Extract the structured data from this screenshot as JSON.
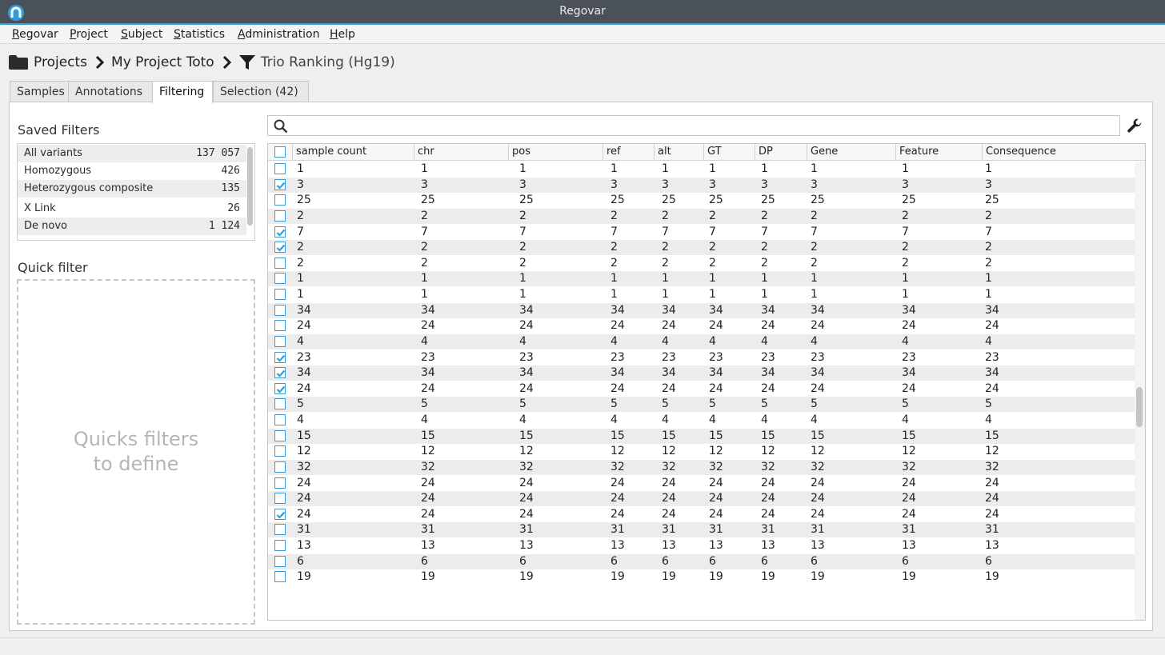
{
  "window": {
    "title": "Regovar"
  },
  "menu": [
    {
      "label": "Regovar",
      "mnemonic": "R"
    },
    {
      "label": "Project",
      "mnemonic": "P"
    },
    {
      "label": "Subject",
      "mnemonic": "S"
    },
    {
      "label": "Statistics",
      "mnemonic": "S"
    },
    {
      "label": "Administration",
      "mnemonic": "A"
    },
    {
      "label": "Help",
      "mnemonic": "H"
    }
  ],
  "breadcrumb": {
    "items": [
      "Projects",
      "My Project Toto"
    ],
    "current": "Trio Ranking (Hg19)"
  },
  "tabs": [
    {
      "label": "Samples",
      "active": false
    },
    {
      "label": "Annotations",
      "active": false
    },
    {
      "label": "Filtering",
      "active": true
    },
    {
      "label": "Selection (42)",
      "active": false
    }
  ],
  "saved_filters": {
    "title": "Saved Filters",
    "items": [
      {
        "name": "All variants",
        "count": "137 057"
      },
      {
        "name": "Homozygous",
        "count": "426"
      },
      {
        "name": "Heterozygous composite",
        "count": "135"
      },
      {
        "name": "X Link",
        "count": "26"
      },
      {
        "name": "De novo",
        "count": "1 124"
      }
    ]
  },
  "quick_filter": {
    "title": "Quick filter",
    "placeholder": "Quicks filters\nto define"
  },
  "search": {
    "value": "",
    "placeholder": ""
  },
  "table": {
    "columns": [
      "sample count",
      "chr",
      "pos",
      "ref",
      "alt",
      "GT",
      "DP",
      "Gene",
      "Feature",
      "Consequence"
    ],
    "rows": [
      {
        "checked": false,
        "value": "1"
      },
      {
        "checked": true,
        "value": "3"
      },
      {
        "checked": false,
        "value": "25"
      },
      {
        "checked": false,
        "value": "2"
      },
      {
        "checked": true,
        "value": "7"
      },
      {
        "checked": true,
        "value": "2"
      },
      {
        "checked": false,
        "value": "2"
      },
      {
        "checked": false,
        "value": "1"
      },
      {
        "checked": false,
        "value": "1"
      },
      {
        "checked": false,
        "value": "34"
      },
      {
        "checked": false,
        "value": "24"
      },
      {
        "checked": false,
        "value": "4"
      },
      {
        "checked": true,
        "value": "23"
      },
      {
        "checked": true,
        "value": "34"
      },
      {
        "checked": true,
        "value": "24"
      },
      {
        "checked": false,
        "value": "5"
      },
      {
        "checked": false,
        "value": "4"
      },
      {
        "checked": false,
        "value": "15"
      },
      {
        "checked": false,
        "value": "12"
      },
      {
        "checked": false,
        "value": "32"
      },
      {
        "checked": false,
        "value": "24"
      },
      {
        "checked": false,
        "value": "24"
      },
      {
        "checked": true,
        "value": "24"
      },
      {
        "checked": false,
        "value": "31"
      },
      {
        "checked": false,
        "value": "13"
      },
      {
        "checked": false,
        "value": "6"
      },
      {
        "checked": false,
        "value": "19"
      }
    ]
  },
  "colors": {
    "accent": "#2f9ed6",
    "titlebar": "#4a5158"
  }
}
